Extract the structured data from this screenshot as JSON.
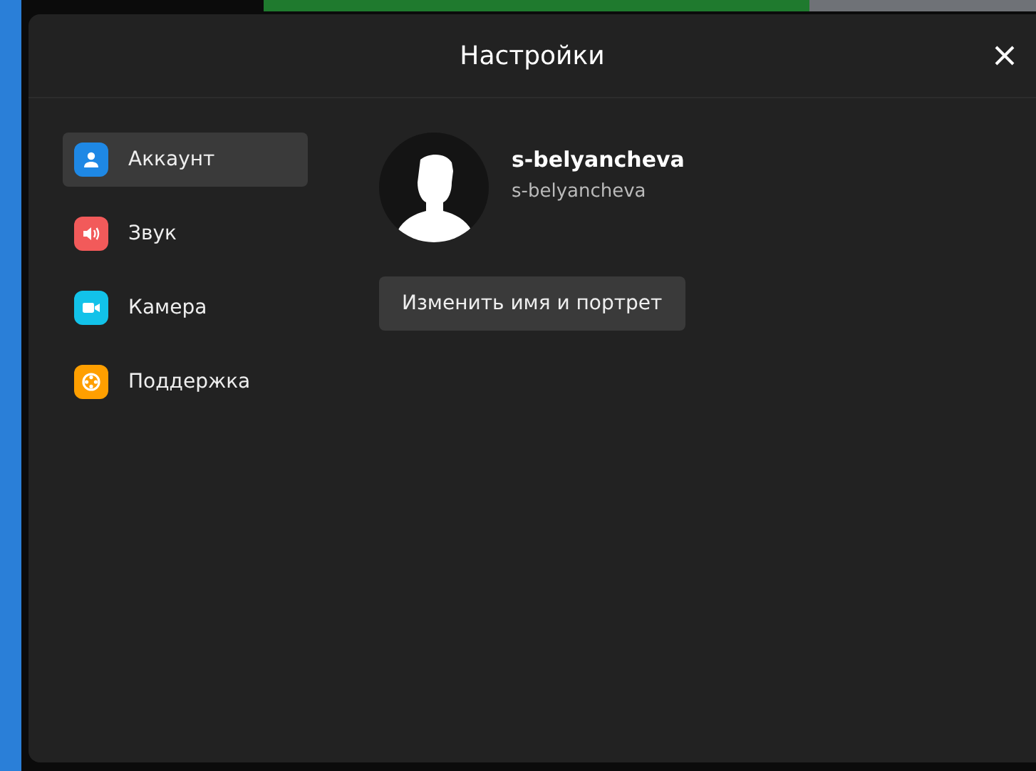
{
  "dialog": {
    "title": "Настройки"
  },
  "sidebar": {
    "items": [
      {
        "label": "Аккаунт",
        "kind": "account",
        "color": "#1e88e5",
        "selected": true
      },
      {
        "label": "Звук",
        "kind": "sound",
        "color": "#f25a5a",
        "selected": false
      },
      {
        "label": "Камера",
        "kind": "camera",
        "color": "#12c2e9",
        "selected": false
      },
      {
        "label": "Поддержка",
        "kind": "support",
        "color": "#ff9f00",
        "selected": false
      }
    ]
  },
  "profile": {
    "name": "s-belyancheva",
    "login": "s-belyancheva",
    "edit_button": "Изменить имя и портрет"
  }
}
